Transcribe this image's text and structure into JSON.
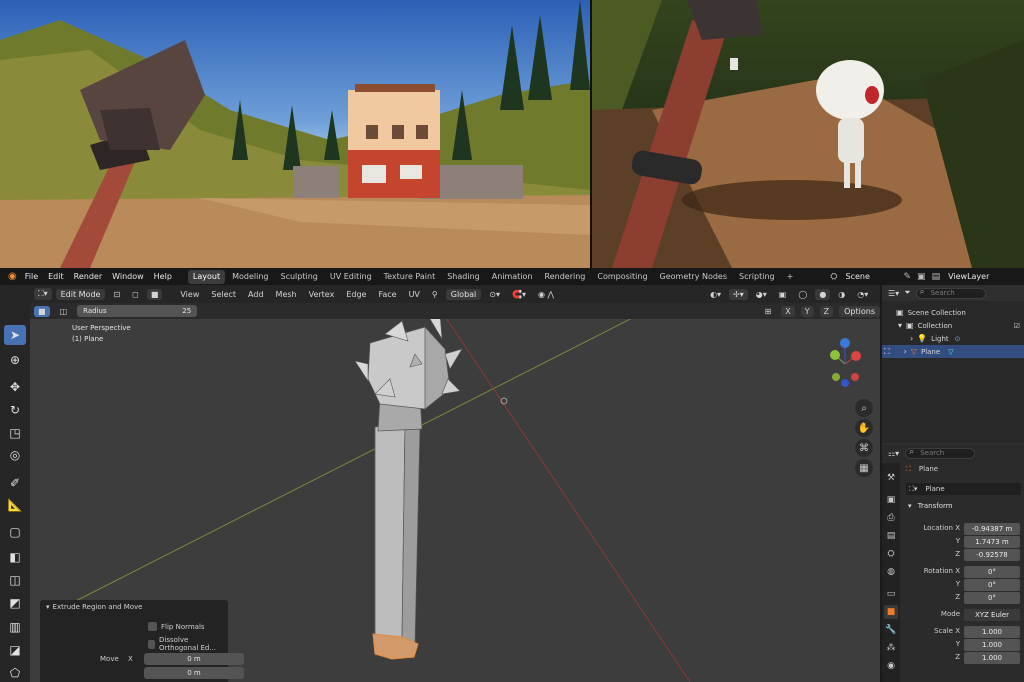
{
  "topbar": {
    "menus": [
      "File",
      "Edit",
      "Render",
      "Window",
      "Help"
    ],
    "workspaces": [
      "Layout",
      "Modeling",
      "Sculpting",
      "UV Editing",
      "Texture Paint",
      "Shading",
      "Animation",
      "Rendering",
      "Compositing",
      "Geometry Nodes",
      "Scripting"
    ],
    "active_workspace": "Layout",
    "add_tab": "+",
    "scene": "Scene",
    "view_layer": "ViewLayer"
  },
  "view_header": {
    "mode": "Edit Mode",
    "menus": [
      "View",
      "Select",
      "Add",
      "Mesh",
      "Vertex",
      "Edge",
      "Face",
      "UV"
    ],
    "orientation": "Global",
    "options": "Options",
    "axis_x": "X",
    "axis_y": "Y",
    "axis_z": "Z"
  },
  "tool_settings": {
    "radius_label": "Radius",
    "radius_value": "25"
  },
  "viewport": {
    "perspective": "User Perspective",
    "object": "(1) Plane"
  },
  "operator_panel": {
    "title": "Extrude Region and Move",
    "flip_normals": "Flip Normals",
    "dissolve": "Dissolve Orthogonal Ed...",
    "move_label": "Move",
    "x_label": "X",
    "x_value": "0 m",
    "y_value": "0 m"
  },
  "outliner": {
    "search_placeholder": "Search",
    "items": [
      {
        "label": "Scene Collection"
      },
      {
        "label": "Collection"
      },
      {
        "label": "Light"
      },
      {
        "label": "Plane"
      }
    ]
  },
  "properties": {
    "search_placeholder": "Search",
    "object_name": "Plane",
    "data_name": "Plane",
    "transform_header": "Transform",
    "location_label": "Location X",
    "location": [
      "-0.94387 m",
      "1.7473 m",
      "-0.92578"
    ],
    "rotation_label": "Rotation X",
    "rotation": [
      "0°",
      "0°",
      "0°"
    ],
    "mode_label": "Mode",
    "mode_value": "XYZ Euler",
    "scale_label": "Scale X",
    "scale": [
      "1.000",
      "1.000",
      "1.000"
    ],
    "y_label": "Y",
    "z_label": "Z"
  },
  "colors": {
    "accent": "#4772b3",
    "selection_orange": "#f07a29",
    "viewport_bg": "#3d3d3d"
  }
}
